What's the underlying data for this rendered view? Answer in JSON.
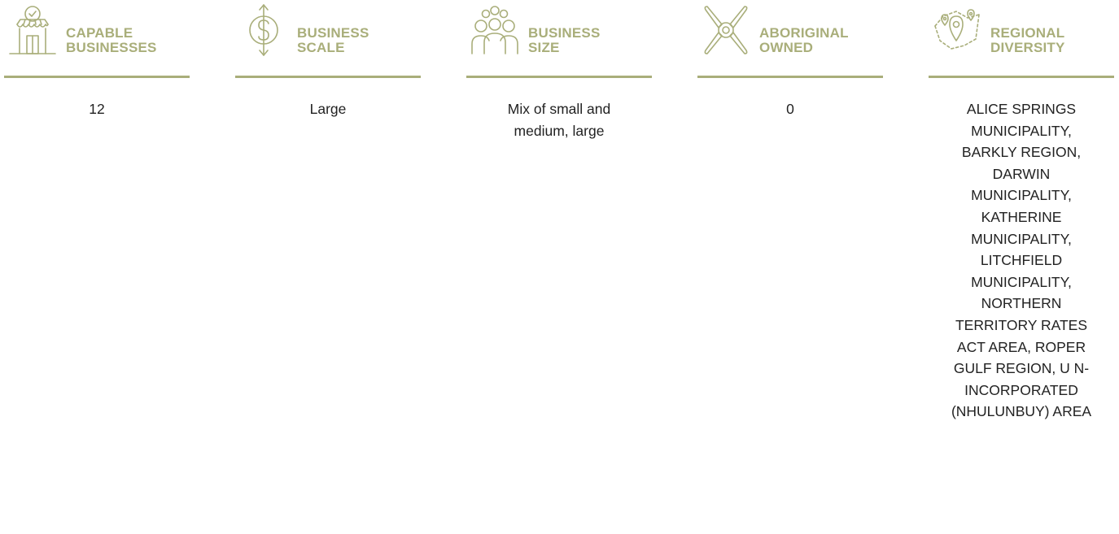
{
  "accent_color": "#a9ae7a",
  "text_color": "#222222",
  "columns": [
    {
      "icon": "storefront-icon",
      "title": "CAPABLE\nBUSINESSES",
      "value": "12"
    },
    {
      "icon": "dollar-scale-icon",
      "title": "BUSINESS\nSCALE",
      "value": "Large"
    },
    {
      "icon": "people-group-icon",
      "title": "BUSINESS\nSIZE",
      "value": "Mix of small and medium, large"
    },
    {
      "icon": "crossed-keys-icon",
      "title": "ABORIGINAL\nOWNED",
      "value": "0"
    },
    {
      "icon": "map-pins-icon",
      "title": "REGIONAL\nDIVERSITY",
      "value": "ALICE SPRINGS MUNICIPALITY, BARKLY REGION, DARWIN MUNICIPALITY, KATHERINE MUNICIPALITY, LITCHFIELD MUNICIPALITY, NORTHERN TERRITORY RATES ACT AREA, ROPER GULF REGION, U N-INCORPORATED (NHULUNBUY) AREA"
    }
  ]
}
